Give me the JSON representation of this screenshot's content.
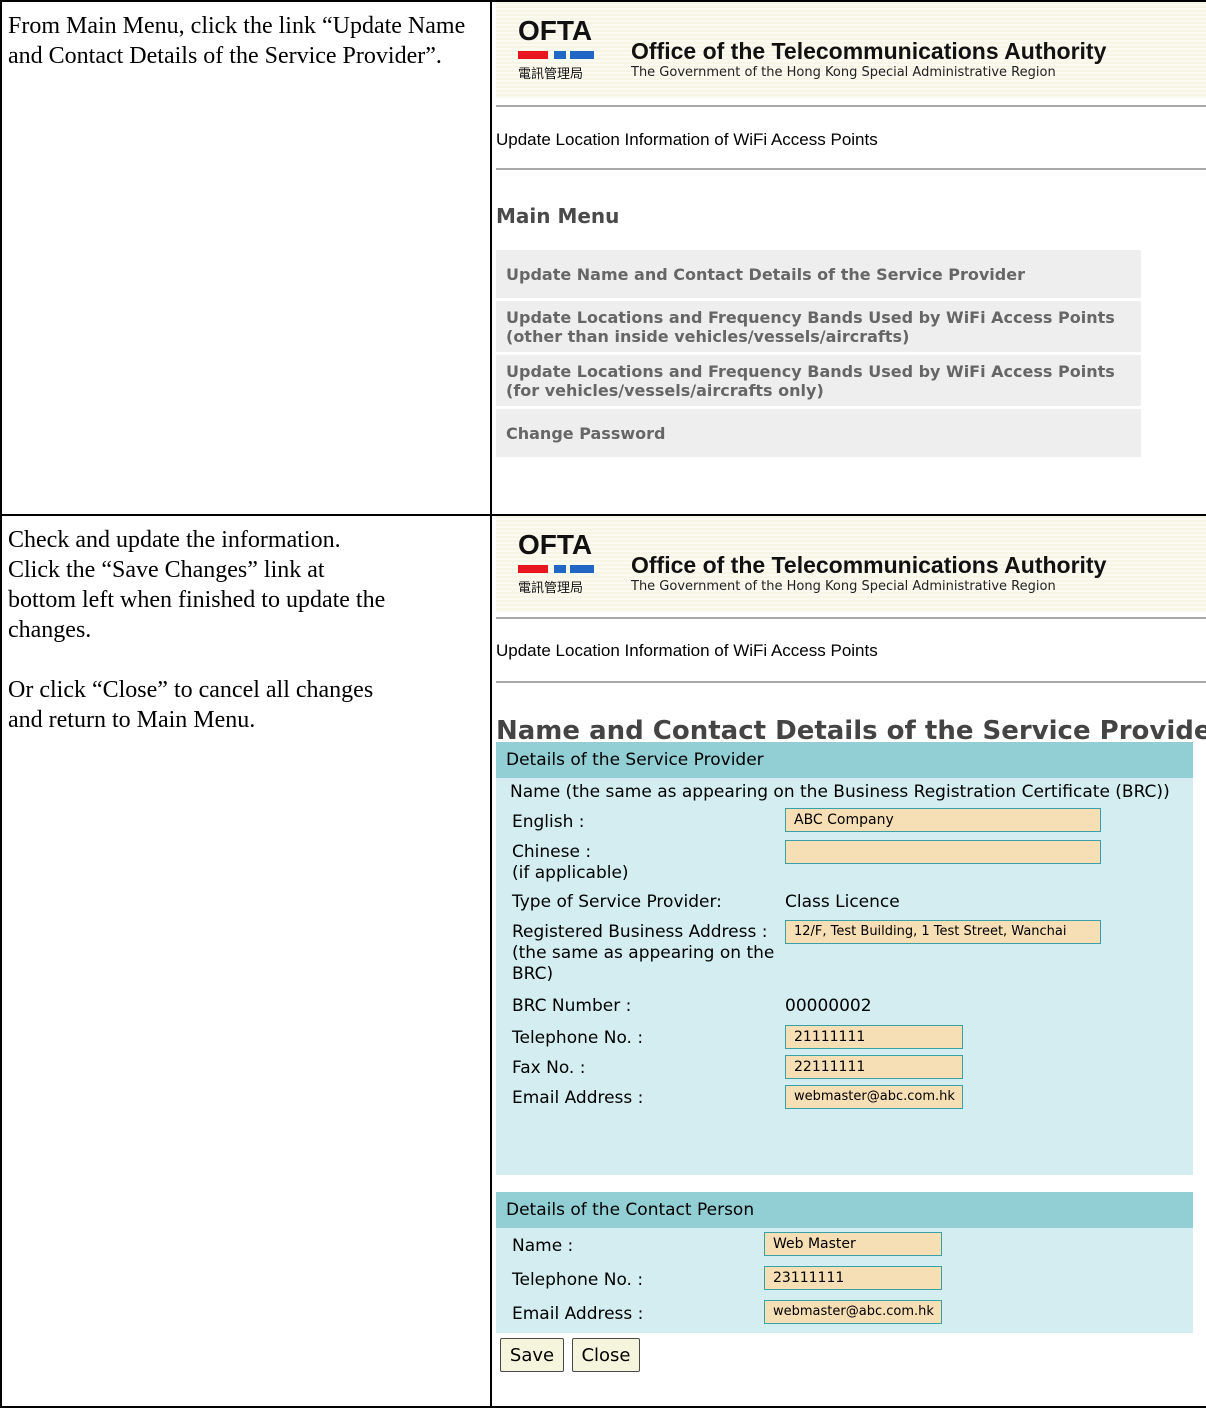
{
  "steps": [
    {
      "instruction": "From Main Menu, click the link “Update Name and Contact Details of the Service Provider”.",
      "screen": {
        "logo_text": "OFTA",
        "logo_chinese": "電訊管理局",
        "banner_title": "Office of the Telecommunications Authority",
        "banner_subtitle": "The Government of the Hong Kong Special Administrative Region",
        "app_title": "Update Location Information of WiFi Access Points",
        "menu_heading": "Main Menu",
        "menu_items": [
          "Update Name and Contact Details of the Service Provider",
          "Update Locations and Frequency Bands Used by WiFi Access Points",
          "(other than inside vehicles/vessels/aircrafts)",
          "Update Locations and Frequency Bands Used by WiFi Access Points",
          "(for vehicles/vessels/aircrafts only)",
          "Change Password"
        ]
      }
    },
    {
      "instruction_lines": [
        "Check and update the information.",
        "Click the “Save Changes” link at",
        "bottom left when finished to update the",
        "changes.",
        "Or click “Close” to cancel all changes",
        "and return to Main Menu."
      ],
      "screen": {
        "logo_text": "OFTA",
        "logo_chinese": "電訊管理局",
        "banner_title": "Office of the Telecommunications Authority",
        "banner_subtitle": "The Government of the Hong Kong Special Administrative Region",
        "app_title": "Update Location Information of WiFi Access Points",
        "page_heading": "Name and Contact Details of the Service Provider",
        "provider_section": {
          "title": "Details of the Service Provider",
          "name_note": "Name (the same as appearing on the Business Registration Certificate (BRC))",
          "english_label": "English :",
          "english_value": "ABC Company",
          "chinese_label": "Chinese :",
          "chinese_note": "(if applicable)",
          "chinese_value": "",
          "type_label": "Type of Service Provider:",
          "type_value": "Class Licence",
          "address_label": "Registered Business Address :",
          "address_note_1": "(the same as appearing on the",
          "address_note_2": "BRC)",
          "address_value": "12/F, Test Building, 1 Test Street, Wanchai",
          "brc_label": "BRC Number :",
          "brc_value": "00000002",
          "tel_label": "Telephone No. :",
          "tel_value": "21111111",
          "fax_label": "Fax No. :",
          "fax_value": "22111111",
          "email_label": "Email Address :",
          "email_value": "webmaster@abc.com.hk"
        },
        "contact_section": {
          "title": "Details of the Contact Person",
          "name_label": "Name :",
          "name_value": "Web Master",
          "tel_label": "Telephone No. :",
          "tel_value": "23111111",
          "email_label": "Email Address :",
          "email_value": "webmaster@abc.com.hk"
        },
        "buttons": {
          "save": "Save",
          "close": "Close"
        }
      }
    }
  ]
}
